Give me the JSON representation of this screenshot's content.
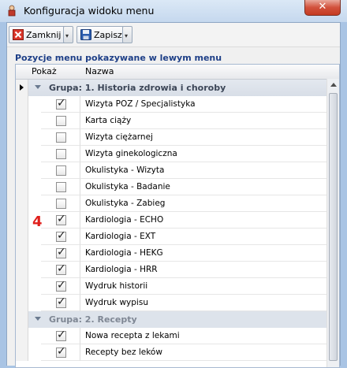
{
  "window": {
    "title": "Konfiguracja widoku menu",
    "close_glyph": "✕"
  },
  "toolbar": {
    "close_label": "Zamknij",
    "save_label": "Zapisz",
    "dropdown_glyph": "▾"
  },
  "section_label": "Pozycje menu pokazywane w lewym menu",
  "grid": {
    "columns": [
      "Pokaż",
      "Nazwa"
    ],
    "groups": [
      {
        "label": "Grupa: 1. Historia zdrowia i choroby",
        "items": [
          {
            "name": "Wizyta POZ / Specjalistyka",
            "checked": true
          },
          {
            "name": "Karta ciąży",
            "checked": false
          },
          {
            "name": "Wizyta ciężarnej",
            "checked": false
          },
          {
            "name": "Wizyta ginekologiczna",
            "checked": false
          },
          {
            "name": "Okulistyka - Wizyta",
            "checked": false
          },
          {
            "name": "Okulistyka - Badanie",
            "checked": false
          },
          {
            "name": "Okulistyka - Zabieg",
            "checked": false
          },
          {
            "name": "Kardiologia - ECHO",
            "checked": true
          },
          {
            "name": "Kardiologia - EXT",
            "checked": true
          },
          {
            "name": "Kardiologia - HEKG",
            "checked": true
          },
          {
            "name": "Kardiologia - HRR",
            "checked": true
          },
          {
            "name": "Wydruk historii",
            "checked": true
          },
          {
            "name": "Wydruk wypisu",
            "checked": true
          }
        ]
      },
      {
        "label": "Grupa: 2. Recepty",
        "items": [
          {
            "name": "Nowa recepta z lekami",
            "checked": true
          },
          {
            "name": "Recepty  bez leków",
            "checked": true
          }
        ]
      }
    ]
  },
  "annotation": "4",
  "colors": {
    "accent": "#1e3f87",
    "annotation": "#e0201c",
    "titlebar": "#c5d8ee"
  }
}
